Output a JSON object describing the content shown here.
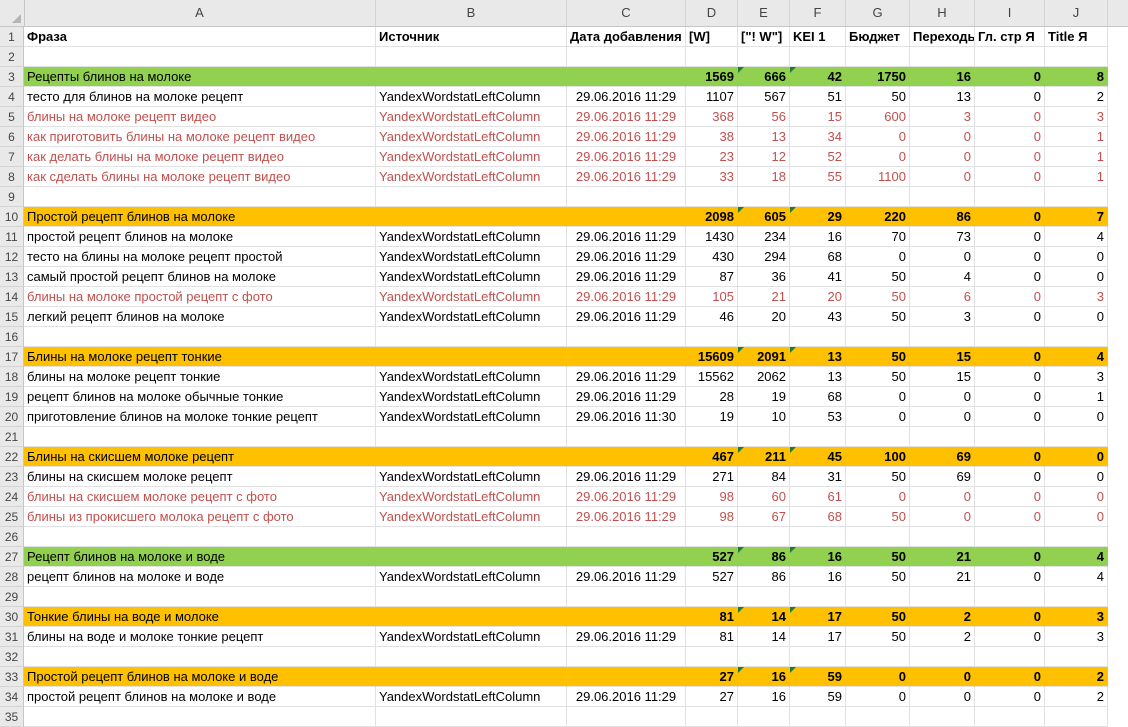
{
  "columns": [
    "A",
    "B",
    "C",
    "D",
    "E",
    "F",
    "G",
    "H",
    "I",
    "J"
  ],
  "rows": [
    {
      "n": "1",
      "type": "hdr",
      "cells": [
        "Фраза",
        "Источник",
        "Дата добавления",
        "[W]",
        "[\"! W\"]",
        "KEI 1",
        "Бюджет",
        "Переходы",
        "Гл. стр Я",
        "Title Я"
      ]
    },
    {
      "n": "2",
      "type": "empty",
      "cells": [
        "",
        "",
        "",
        "",
        "",
        "",
        "",
        "",
        "",
        ""
      ]
    },
    {
      "n": "3",
      "type": "green",
      "cells": [
        "Рецепты блинов на молоке",
        "",
        "",
        "1569",
        "666",
        "42",
        "1750",
        "16",
        "0",
        "8"
      ]
    },
    {
      "n": "4",
      "type": "normal",
      "cells": [
        "тесто для блинов на молоке рецепт",
        "YandexWordstatLeftColumn",
        "29.06.2016 11:29",
        "1107",
        "567",
        "51",
        "50",
        "13",
        "0",
        "2"
      ]
    },
    {
      "n": "5",
      "type": "red",
      "cells": [
        "блины на молоке рецепт видео",
        "YandexWordstatLeftColumn",
        "29.06.2016 11:29",
        "368",
        "56",
        "15",
        "600",
        "3",
        "0",
        "3"
      ]
    },
    {
      "n": "6",
      "type": "red",
      "cells": [
        "как приготовить блины на молоке рецепт видео",
        "YandexWordstatLeftColumn",
        "29.06.2016 11:29",
        "38",
        "13",
        "34",
        "0",
        "0",
        "0",
        "1"
      ]
    },
    {
      "n": "7",
      "type": "red",
      "cells": [
        "как делать блины на молоке рецепт видео",
        "YandexWordstatLeftColumn",
        "29.06.2016 11:29",
        "23",
        "12",
        "52",
        "0",
        "0",
        "0",
        "1"
      ]
    },
    {
      "n": "8",
      "type": "red",
      "cells": [
        "как сделать блины на молоке рецепт видео",
        "YandexWordstatLeftColumn",
        "29.06.2016 11:29",
        "33",
        "18",
        "55",
        "1100",
        "0",
        "0",
        "1"
      ]
    },
    {
      "n": "9",
      "type": "empty",
      "cells": [
        "",
        "",
        "",
        "",
        "",
        "",
        "",
        "",
        "",
        ""
      ]
    },
    {
      "n": "10",
      "type": "orange",
      "cells": [
        "Простой рецепт блинов на молоке",
        "",
        "",
        "2098",
        "605",
        "29",
        "220",
        "86",
        "0",
        "7"
      ]
    },
    {
      "n": "11",
      "type": "normal",
      "cells": [
        "простой рецепт блинов на молоке",
        "YandexWordstatLeftColumn",
        "29.06.2016 11:29",
        "1430",
        "234",
        "16",
        "70",
        "73",
        "0",
        "4"
      ]
    },
    {
      "n": "12",
      "type": "normal",
      "cells": [
        "тесто на блины на молоке рецепт простой",
        "YandexWordstatLeftColumn",
        "29.06.2016 11:29",
        "430",
        "294",
        "68",
        "0",
        "0",
        "0",
        "0"
      ]
    },
    {
      "n": "13",
      "type": "normal",
      "cells": [
        "самый простой рецепт блинов на молоке",
        "YandexWordstatLeftColumn",
        "29.06.2016 11:29",
        "87",
        "36",
        "41",
        "50",
        "4",
        "0",
        "0"
      ]
    },
    {
      "n": "14",
      "type": "red",
      "cells": [
        "блины на молоке простой рецепт с фото",
        "YandexWordstatLeftColumn",
        "29.06.2016 11:29",
        "105",
        "21",
        "20",
        "50",
        "6",
        "0",
        "3"
      ]
    },
    {
      "n": "15",
      "type": "normal",
      "cells": [
        "легкий рецепт блинов на молоке",
        "YandexWordstatLeftColumn",
        "29.06.2016 11:29",
        "46",
        "20",
        "43",
        "50",
        "3",
        "0",
        "0"
      ]
    },
    {
      "n": "16",
      "type": "empty",
      "cells": [
        "",
        "",
        "",
        "",
        "",
        "",
        "",
        "",
        "",
        ""
      ]
    },
    {
      "n": "17",
      "type": "orange",
      "cells": [
        "Блины на молоке рецепт тонкие",
        "",
        "",
        "15609",
        "2091",
        "13",
        "50",
        "15",
        "0",
        "4"
      ]
    },
    {
      "n": "18",
      "type": "normal",
      "cells": [
        "блины на молоке рецепт тонкие",
        "YandexWordstatLeftColumn",
        "29.06.2016 11:29",
        "15562",
        "2062",
        "13",
        "50",
        "15",
        "0",
        "3"
      ]
    },
    {
      "n": "19",
      "type": "normal",
      "cells": [
        "рецепт блинов на молоке обычные тонкие",
        "YandexWordstatLeftColumn",
        "29.06.2016 11:29",
        "28",
        "19",
        "68",
        "0",
        "0",
        "0",
        "1"
      ]
    },
    {
      "n": "20",
      "type": "normal",
      "cells": [
        "приготовление блинов на молоке тонкие рецепт",
        "YandexWordstatLeftColumn",
        "29.06.2016 11:30",
        "19",
        "10",
        "53",
        "0",
        "0",
        "0",
        "0"
      ]
    },
    {
      "n": "21",
      "type": "empty",
      "cells": [
        "",
        "",
        "",
        "",
        "",
        "",
        "",
        "",
        "",
        ""
      ]
    },
    {
      "n": "22",
      "type": "orange",
      "cells": [
        "Блины на скисшем молоке рецепт",
        "",
        "",
        "467",
        "211",
        "45",
        "100",
        "69",
        "0",
        "0"
      ]
    },
    {
      "n": "23",
      "type": "normal",
      "cells": [
        "блины на скисшем молоке рецепт",
        "YandexWordstatLeftColumn",
        "29.06.2016 11:29",
        "271",
        "84",
        "31",
        "50",
        "69",
        "0",
        "0"
      ]
    },
    {
      "n": "24",
      "type": "red",
      "cells": [
        "блины на скисшем молоке рецепт с фото",
        "YandexWordstatLeftColumn",
        "29.06.2016 11:29",
        "98",
        "60",
        "61",
        "0",
        "0",
        "0",
        "0"
      ]
    },
    {
      "n": "25",
      "type": "red",
      "cells": [
        "блины из прокисшего молока рецепт с фото",
        "YandexWordstatLeftColumn",
        "29.06.2016 11:29",
        "98",
        "67",
        "68",
        "50",
        "0",
        "0",
        "0"
      ]
    },
    {
      "n": "26",
      "type": "empty",
      "cells": [
        "",
        "",
        "",
        "",
        "",
        "",
        "",
        "",
        "",
        ""
      ]
    },
    {
      "n": "27",
      "type": "green",
      "cells": [
        "Рецепт блинов на молоке и воде",
        "",
        "",
        "527",
        "86",
        "16",
        "50",
        "21",
        "0",
        "4"
      ]
    },
    {
      "n": "28",
      "type": "normal",
      "cells": [
        "рецепт блинов на молоке и воде",
        "YandexWordstatLeftColumn",
        "29.06.2016 11:29",
        "527",
        "86",
        "16",
        "50",
        "21",
        "0",
        "4"
      ]
    },
    {
      "n": "29",
      "type": "empty",
      "cells": [
        "",
        "",
        "",
        "",
        "",
        "",
        "",
        "",
        "",
        ""
      ]
    },
    {
      "n": "30",
      "type": "orange",
      "cells": [
        "Тонкие блины на воде и молоке",
        "",
        "",
        "81",
        "14",
        "17",
        "50",
        "2",
        "0",
        "3"
      ]
    },
    {
      "n": "31",
      "type": "normal",
      "cells": [
        "блины на воде и молоке тонкие рецепт",
        "YandexWordstatLeftColumn",
        "29.06.2016 11:29",
        "81",
        "14",
        "17",
        "50",
        "2",
        "0",
        "3"
      ]
    },
    {
      "n": "32",
      "type": "empty",
      "cells": [
        "",
        "",
        "",
        "",
        "",
        "",
        "",
        "",
        "",
        ""
      ]
    },
    {
      "n": "33",
      "type": "orange",
      "cells": [
        "Простой рецепт блинов на молоке и воде",
        "",
        "",
        "27",
        "16",
        "59",
        "0",
        "0",
        "0",
        "2"
      ]
    },
    {
      "n": "34",
      "type": "normal",
      "cells": [
        "простой рецепт блинов на молоке и воде",
        "YandexWordstatLeftColumn",
        "29.06.2016 11:29",
        "27",
        "16",
        "59",
        "0",
        "0",
        "0",
        "2"
      ]
    },
    {
      "n": "35",
      "type": "empty",
      "cells": [
        "",
        "",
        "",
        "",
        "",
        "",
        "",
        "",
        "",
        ""
      ]
    }
  ]
}
